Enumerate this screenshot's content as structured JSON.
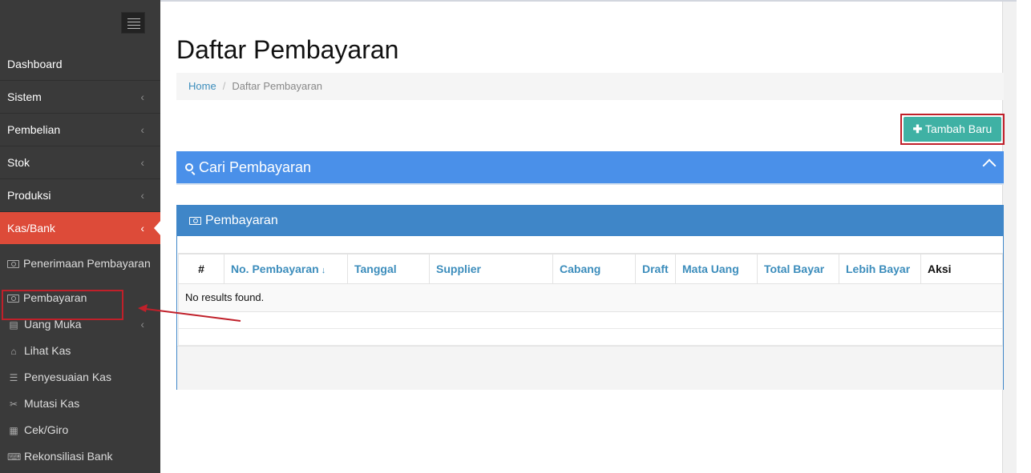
{
  "sidebar": {
    "items": [
      {
        "label": "Dashboard",
        "chevron": false
      },
      {
        "label": "Sistem",
        "chevron": true
      },
      {
        "label": "Pembelian",
        "chevron": true
      },
      {
        "label": "Stok",
        "chevron": true
      },
      {
        "label": "Produksi",
        "chevron": true
      },
      {
        "label": "Kas/Bank",
        "chevron": true,
        "active": true
      }
    ],
    "subitems": [
      {
        "label": "Penerimaan Pembayaran",
        "icon": "money-icon"
      },
      {
        "label": "Pembayaran",
        "icon": "money-icon"
      },
      {
        "label": "Uang Muka",
        "icon": "file-icon"
      },
      {
        "label": "Lihat Kas",
        "icon": "bank-icon"
      },
      {
        "label": "Penyesuaian Kas",
        "icon": "list-icon"
      },
      {
        "label": "Mutasi Kas",
        "icon": "scissors-icon"
      },
      {
        "label": "Cek/Giro",
        "icon": "list-alt-icon"
      },
      {
        "label": "Rekonsiliasi Bank",
        "icon": "keyboard-icon"
      }
    ],
    "chevron_glyph": "‹"
  },
  "page": {
    "title": "Daftar Pembayaran",
    "breadcrumb": {
      "home": "Home",
      "current": "Daftar Pembayaran"
    },
    "add_button": "Tambah Baru",
    "search_title": "Cari Pembayaran",
    "panel_title": "Pembayaran"
  },
  "table": {
    "headers": [
      "#",
      "No. Pembayaran",
      "Tanggal",
      "Supplier",
      "Cabang",
      "Draft",
      "Mata Uang",
      "Total Bayar",
      "Lebih Bayar",
      "Aksi"
    ],
    "empty_text": "No results found."
  },
  "colors": {
    "sidebar_bg": "#3a3a3a",
    "active_bg": "#dd4b39",
    "primary": "#3f86c8",
    "search_bg": "#4a90e9",
    "add_button": "#3fb1a4",
    "highlight": "#c0202a"
  }
}
